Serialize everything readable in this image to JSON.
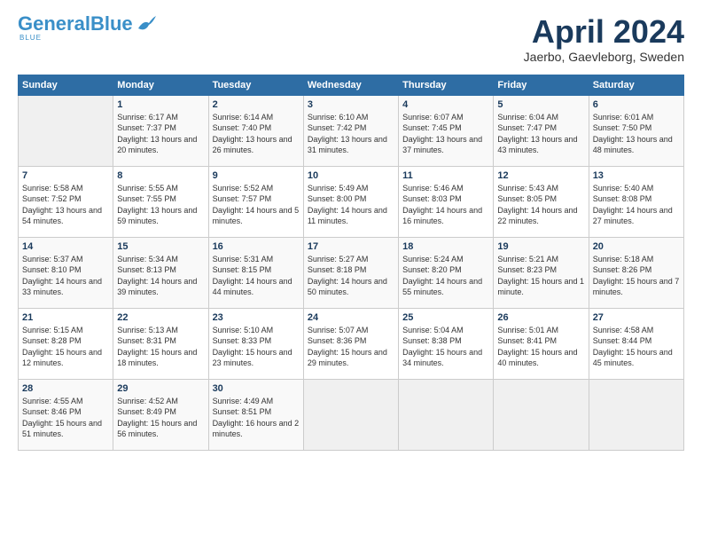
{
  "header": {
    "logo_general": "General",
    "logo_blue": "Blue",
    "month_title": "April 2024",
    "location": "Jaerbo, Gaevleborg, Sweden"
  },
  "calendar": {
    "days_of_week": [
      "Sunday",
      "Monday",
      "Tuesday",
      "Wednesday",
      "Thursday",
      "Friday",
      "Saturday"
    ],
    "weeks": [
      [
        {
          "num": "",
          "sunrise": "",
          "sunset": "",
          "daylight": ""
        },
        {
          "num": "1",
          "sunrise": "Sunrise: 6:17 AM",
          "sunset": "Sunset: 7:37 PM",
          "daylight": "Daylight: 13 hours and 20 minutes."
        },
        {
          "num": "2",
          "sunrise": "Sunrise: 6:14 AM",
          "sunset": "Sunset: 7:40 PM",
          "daylight": "Daylight: 13 hours and 26 minutes."
        },
        {
          "num": "3",
          "sunrise": "Sunrise: 6:10 AM",
          "sunset": "Sunset: 7:42 PM",
          "daylight": "Daylight: 13 hours and 31 minutes."
        },
        {
          "num": "4",
          "sunrise": "Sunrise: 6:07 AM",
          "sunset": "Sunset: 7:45 PM",
          "daylight": "Daylight: 13 hours and 37 minutes."
        },
        {
          "num": "5",
          "sunrise": "Sunrise: 6:04 AM",
          "sunset": "Sunset: 7:47 PM",
          "daylight": "Daylight: 13 hours and 43 minutes."
        },
        {
          "num": "6",
          "sunrise": "Sunrise: 6:01 AM",
          "sunset": "Sunset: 7:50 PM",
          "daylight": "Daylight: 13 hours and 48 minutes."
        }
      ],
      [
        {
          "num": "7",
          "sunrise": "Sunrise: 5:58 AM",
          "sunset": "Sunset: 7:52 PM",
          "daylight": "Daylight: 13 hours and 54 minutes."
        },
        {
          "num": "8",
          "sunrise": "Sunrise: 5:55 AM",
          "sunset": "Sunset: 7:55 PM",
          "daylight": "Daylight: 13 hours and 59 minutes."
        },
        {
          "num": "9",
          "sunrise": "Sunrise: 5:52 AM",
          "sunset": "Sunset: 7:57 PM",
          "daylight": "Daylight: 14 hours and 5 minutes."
        },
        {
          "num": "10",
          "sunrise": "Sunrise: 5:49 AM",
          "sunset": "Sunset: 8:00 PM",
          "daylight": "Daylight: 14 hours and 11 minutes."
        },
        {
          "num": "11",
          "sunrise": "Sunrise: 5:46 AM",
          "sunset": "Sunset: 8:03 PM",
          "daylight": "Daylight: 14 hours and 16 minutes."
        },
        {
          "num": "12",
          "sunrise": "Sunrise: 5:43 AM",
          "sunset": "Sunset: 8:05 PM",
          "daylight": "Daylight: 14 hours and 22 minutes."
        },
        {
          "num": "13",
          "sunrise": "Sunrise: 5:40 AM",
          "sunset": "Sunset: 8:08 PM",
          "daylight": "Daylight: 14 hours and 27 minutes."
        }
      ],
      [
        {
          "num": "14",
          "sunrise": "Sunrise: 5:37 AM",
          "sunset": "Sunset: 8:10 PM",
          "daylight": "Daylight: 14 hours and 33 minutes."
        },
        {
          "num": "15",
          "sunrise": "Sunrise: 5:34 AM",
          "sunset": "Sunset: 8:13 PM",
          "daylight": "Daylight: 14 hours and 39 minutes."
        },
        {
          "num": "16",
          "sunrise": "Sunrise: 5:31 AM",
          "sunset": "Sunset: 8:15 PM",
          "daylight": "Daylight: 14 hours and 44 minutes."
        },
        {
          "num": "17",
          "sunrise": "Sunrise: 5:27 AM",
          "sunset": "Sunset: 8:18 PM",
          "daylight": "Daylight: 14 hours and 50 minutes."
        },
        {
          "num": "18",
          "sunrise": "Sunrise: 5:24 AM",
          "sunset": "Sunset: 8:20 PM",
          "daylight": "Daylight: 14 hours and 55 minutes."
        },
        {
          "num": "19",
          "sunrise": "Sunrise: 5:21 AM",
          "sunset": "Sunset: 8:23 PM",
          "daylight": "Daylight: 15 hours and 1 minute."
        },
        {
          "num": "20",
          "sunrise": "Sunrise: 5:18 AM",
          "sunset": "Sunset: 8:26 PM",
          "daylight": "Daylight: 15 hours and 7 minutes."
        }
      ],
      [
        {
          "num": "21",
          "sunrise": "Sunrise: 5:15 AM",
          "sunset": "Sunset: 8:28 PM",
          "daylight": "Daylight: 15 hours and 12 minutes."
        },
        {
          "num": "22",
          "sunrise": "Sunrise: 5:13 AM",
          "sunset": "Sunset: 8:31 PM",
          "daylight": "Daylight: 15 hours and 18 minutes."
        },
        {
          "num": "23",
          "sunrise": "Sunrise: 5:10 AM",
          "sunset": "Sunset: 8:33 PM",
          "daylight": "Daylight: 15 hours and 23 minutes."
        },
        {
          "num": "24",
          "sunrise": "Sunrise: 5:07 AM",
          "sunset": "Sunset: 8:36 PM",
          "daylight": "Daylight: 15 hours and 29 minutes."
        },
        {
          "num": "25",
          "sunrise": "Sunrise: 5:04 AM",
          "sunset": "Sunset: 8:38 PM",
          "daylight": "Daylight: 15 hours and 34 minutes."
        },
        {
          "num": "26",
          "sunrise": "Sunrise: 5:01 AM",
          "sunset": "Sunset: 8:41 PM",
          "daylight": "Daylight: 15 hours and 40 minutes."
        },
        {
          "num": "27",
          "sunrise": "Sunrise: 4:58 AM",
          "sunset": "Sunset: 8:44 PM",
          "daylight": "Daylight: 15 hours and 45 minutes."
        }
      ],
      [
        {
          "num": "28",
          "sunrise": "Sunrise: 4:55 AM",
          "sunset": "Sunset: 8:46 PM",
          "daylight": "Daylight: 15 hours and 51 minutes."
        },
        {
          "num": "29",
          "sunrise": "Sunrise: 4:52 AM",
          "sunset": "Sunset: 8:49 PM",
          "daylight": "Daylight: 15 hours and 56 minutes."
        },
        {
          "num": "30",
          "sunrise": "Sunrise: 4:49 AM",
          "sunset": "Sunset: 8:51 PM",
          "daylight": "Daylight: 16 hours and 2 minutes."
        },
        {
          "num": "",
          "sunrise": "",
          "sunset": "",
          "daylight": ""
        },
        {
          "num": "",
          "sunrise": "",
          "sunset": "",
          "daylight": ""
        },
        {
          "num": "",
          "sunrise": "",
          "sunset": "",
          "daylight": ""
        },
        {
          "num": "",
          "sunrise": "",
          "sunset": "",
          "daylight": ""
        }
      ]
    ]
  }
}
